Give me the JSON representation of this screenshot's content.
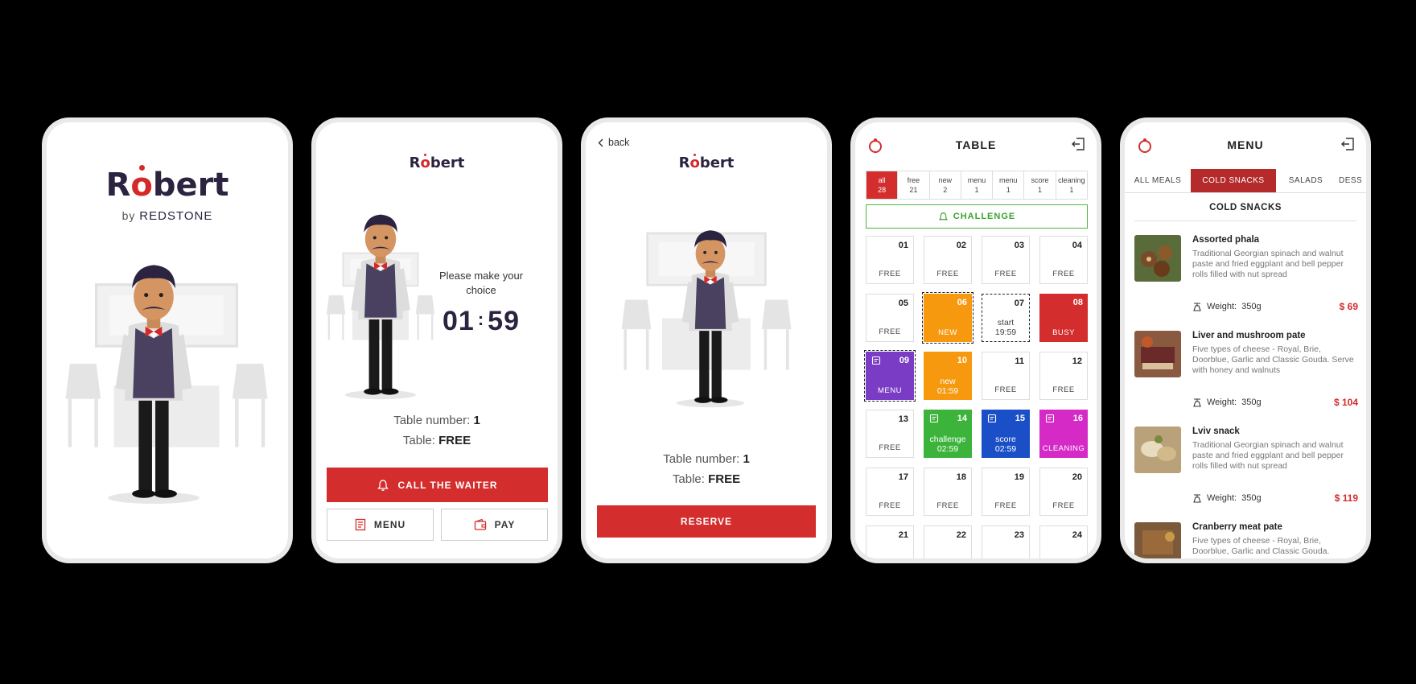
{
  "colors": {
    "accent": "#d32d2d",
    "dark": "#2b2340",
    "challenge": "#3aa22f"
  },
  "brand": {
    "logo_a": "R",
    "logo_o": "o",
    "logo_b": "bert",
    "by": "by",
    "company": "REDSTONE"
  },
  "screen2": {
    "prompt": "Please make your choice",
    "timer_min": "01",
    "timer_sep": ":",
    "timer_sec": "59",
    "table_label": "Table number:",
    "table_number": "1",
    "status_label": "Table:",
    "status": "FREE",
    "call_button": "CALL THE WAITER",
    "menu_button": "MENU",
    "pay_button": "PAY"
  },
  "screen3": {
    "back": "back",
    "table_label": "Table number:",
    "table_number": "1",
    "status_label": "Table:",
    "status": "FREE",
    "reserve_button": "RESERVE"
  },
  "screen4": {
    "title": "TABLE",
    "filters": [
      {
        "label": "all",
        "count": "28"
      },
      {
        "label": "free",
        "count": "21"
      },
      {
        "label": "new",
        "count": "2"
      },
      {
        "label": "menu",
        "count": "1"
      },
      {
        "label": "menu",
        "count": "1"
      },
      {
        "label": "score",
        "count": "1"
      },
      {
        "label": "cleaning",
        "count": "1"
      }
    ],
    "challenge_button": "CHALLENGE",
    "tables": [
      {
        "num": "01",
        "line1": "FREE",
        "line2": ""
      },
      {
        "num": "02",
        "line1": "FREE",
        "line2": ""
      },
      {
        "num": "03",
        "line1": "FREE",
        "line2": ""
      },
      {
        "num": "04",
        "line1": "FREE",
        "line2": ""
      },
      {
        "num": "05",
        "line1": "FREE",
        "line2": ""
      },
      {
        "num": "06",
        "line1": "NEW",
        "line2": ""
      },
      {
        "num": "07",
        "line1": "start",
        "line2": "19:59"
      },
      {
        "num": "08",
        "line1": "BUSY",
        "line2": ""
      },
      {
        "num": "09",
        "line1": "MENU",
        "line2": ""
      },
      {
        "num": "10",
        "line1": "new",
        "line2": "01:59"
      },
      {
        "num": "11",
        "line1": "FREE",
        "line2": ""
      },
      {
        "num": "12",
        "line1": "FREE",
        "line2": ""
      },
      {
        "num": "13",
        "line1": "FREE",
        "line2": ""
      },
      {
        "num": "14",
        "line1": "challenge",
        "line2": "02:59"
      },
      {
        "num": "15",
        "line1": "score",
        "line2": "02:59"
      },
      {
        "num": "16",
        "line1": "CLEANING",
        "line2": ""
      },
      {
        "num": "17",
        "line1": "FREE",
        "line2": ""
      },
      {
        "num": "18",
        "line1": "FREE",
        "line2": ""
      },
      {
        "num": "19",
        "line1": "FREE",
        "line2": ""
      },
      {
        "num": "20",
        "line1": "FREE",
        "line2": ""
      },
      {
        "num": "21",
        "line1": "",
        "line2": ""
      },
      {
        "num": "22",
        "line1": "",
        "line2": ""
      },
      {
        "num": "23",
        "line1": "",
        "line2": ""
      },
      {
        "num": "24",
        "line1": "",
        "line2": ""
      }
    ]
  },
  "screen5": {
    "title": "MENU",
    "tabs": [
      "ALL MEALS",
      "COLD SNACKS",
      "SALADS",
      "DESS"
    ],
    "section": "COLD SNACKS",
    "weight_label": "Weight:",
    "dishes": [
      {
        "name": "Assorted phala",
        "desc": "Traditional Georgian spinach and walnut paste and fried eggplant and bell pepper rolls filled with nut spread",
        "weight": "350g",
        "price": "$ 69"
      },
      {
        "name": "Liver and mushroom pate",
        "desc": "Five types of cheese - Royal, Brie, Doorblue, Garlic and Classic Gouda. Serve with honey and walnuts",
        "weight": "350g",
        "price": "$ 104"
      },
      {
        "name": "Lviv snack",
        "desc": "Traditional Georgian spinach and walnut paste and fried eggplant and bell pepper rolls filled with nut spread",
        "weight": "350g",
        "price": "$ 119"
      },
      {
        "name": "Cranberry meat pate",
        "desc": "Five types of cheese - Royal, Brie, Doorblue, Garlic and Classic Gouda.",
        "weight": "",
        "price": ""
      }
    ]
  }
}
